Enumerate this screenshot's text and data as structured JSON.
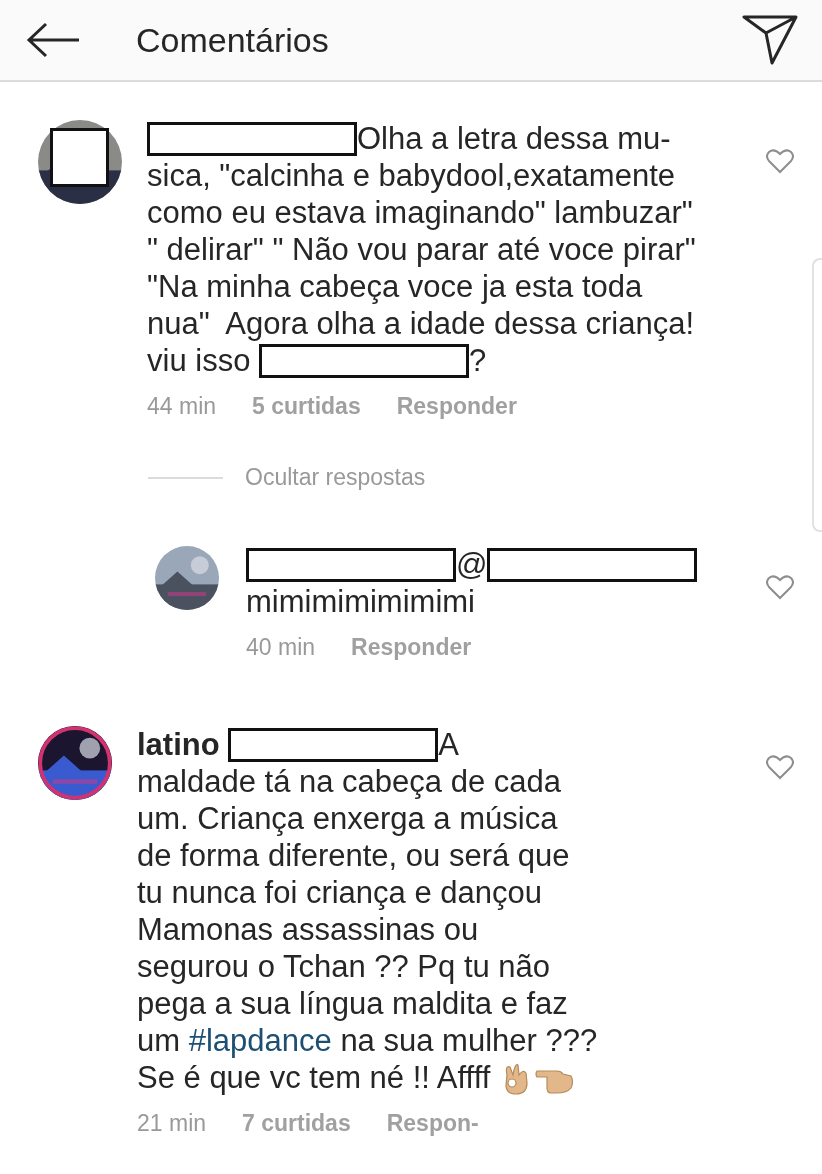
{
  "header": {
    "title": "Comentários"
  },
  "comments": [
    {
      "avatar": {
        "kind": "picture",
        "redacted": true
      },
      "liked": false,
      "reply": false,
      "lines": [
        [
          {
            "kind": "redacted"
          },
          {
            "kind": "text",
            "text": "Olha a letra dessa mu-"
          }
        ],
        [
          {
            "kind": "text",
            "text": "sica, \"calcinha e babydool,exatamente"
          }
        ],
        [
          {
            "kind": "text",
            "text": "como eu estava imaginando\" lambuzar\""
          }
        ],
        [
          {
            "kind": "text",
            "text": "\" delirar\" \" Não vou parar até voce pirar\""
          }
        ],
        [
          {
            "kind": "text",
            "text": "\"Na minha cabeça voce ja esta toda"
          }
        ],
        [
          {
            "kind": "text",
            "text": "nua\"  Agora olha a idade dessa criança!"
          }
        ],
        [
          {
            "kind": "text",
            "text": "viu isso "
          },
          {
            "kind": "redacted"
          },
          {
            "kind": "text",
            "text": "?"
          }
        ]
      ],
      "meta": {
        "time": "44 min",
        "likes": "5 curtidas",
        "reply_label": "Responder"
      },
      "hide_replies": "Ocultar respostas"
    },
    {
      "avatar": {
        "kind": "picture",
        "redacted": false
      },
      "liked": false,
      "reply": true,
      "lines": [
        [
          {
            "kind": "redacted"
          },
          {
            "kind": "text",
            "text": "@"
          },
          {
            "kind": "redacted"
          }
        ],
        [
          {
            "kind": "text",
            "text": "mimimimimimimi"
          }
        ]
      ],
      "meta": {
        "time": "40 min",
        "reply_label": "Responder"
      }
    },
    {
      "avatar": {
        "kind": "picture",
        "redacted": false
      },
      "liked": false,
      "reply": false,
      "lines": [
        [
          {
            "kind": "username",
            "text": "latino "
          },
          {
            "kind": "redacted"
          },
          {
            "kind": "text",
            "text": "A"
          }
        ],
        [
          {
            "kind": "text",
            "text": "maldade tá na cabeça de cada"
          }
        ],
        [
          {
            "kind": "text",
            "text": "um. Criança enxerga a música"
          }
        ],
        [
          {
            "kind": "text",
            "text": "de forma diferente, ou será que"
          }
        ],
        [
          {
            "kind": "text",
            "text": "tu nunca foi criança e dançou"
          }
        ],
        [
          {
            "kind": "text",
            "text": "Mamonas assassinas ou"
          }
        ],
        [
          {
            "kind": "text",
            "text": "segurou o Tchan ?? Pq tu não"
          }
        ],
        [
          {
            "kind": "text",
            "text": "pega a sua língua maldita e faz"
          }
        ],
        [
          {
            "kind": "text",
            "text": "um "
          },
          {
            "kind": "hashtag",
            "text": "#lapdance"
          },
          {
            "kind": "text",
            "text": " na sua mulher ???"
          }
        ],
        [
          {
            "kind": "text",
            "text": "Se é que vc tem né !! Affff "
          },
          {
            "kind": "ok-hand"
          },
          {
            "kind": "pointing-hand"
          }
        ]
      ],
      "meta": {
        "time": "21 min",
        "likes": "7 curtidas",
        "reply_label": "Respon-"
      }
    }
  ]
}
